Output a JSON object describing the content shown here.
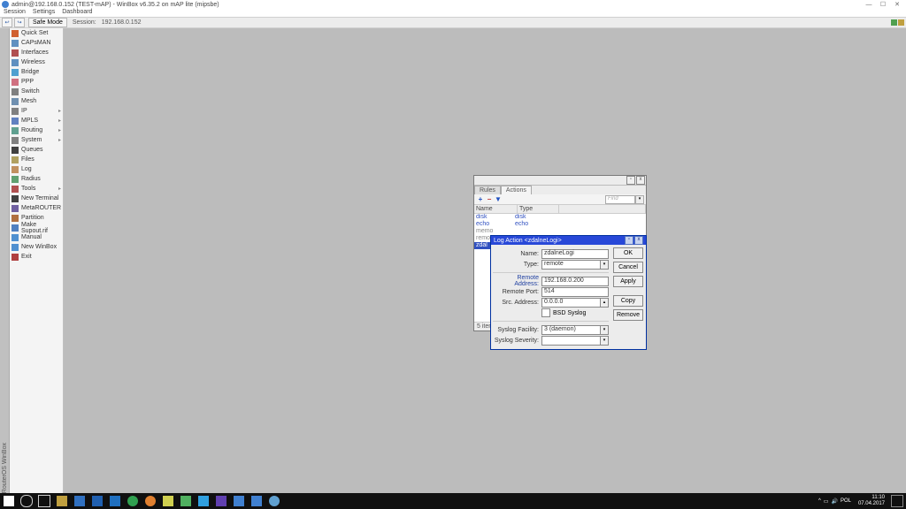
{
  "title": "admin@192.168.0.152 (TEST-mAP) - WinBox v6.35.2 on mAP lite (mipsbe)",
  "menu": {
    "session": "Session",
    "settings": "Settings",
    "dashboard": "Dashboard"
  },
  "toolbar": {
    "safe": "Safe Mode",
    "session_lbl": "Session:",
    "session_ip": "192.168.0.152"
  },
  "vbar_text": "RouterOS WinBox",
  "sidebar": [
    {
      "label": "Quick Set",
      "color": "#d06030"
    },
    {
      "label": "CAPsMAN",
      "color": "#6090c0"
    },
    {
      "label": "Interfaces",
      "color": "#b05050"
    },
    {
      "label": "Wireless",
      "color": "#6090c0"
    },
    {
      "label": "Bridge",
      "color": "#50a0d0"
    },
    {
      "label": "PPP",
      "color": "#d07080"
    },
    {
      "label": "Switch",
      "color": "#808080"
    },
    {
      "label": "Mesh",
      "color": "#7090b0"
    },
    {
      "label": "IP",
      "color": "#808080",
      "sub": true
    },
    {
      "label": "MPLS",
      "color": "#6080c0",
      "sub": true
    },
    {
      "label": "Routing",
      "color": "#60a090",
      "sub": true
    },
    {
      "label": "System",
      "color": "#808080",
      "sub": true
    },
    {
      "label": "Queues",
      "color": "#404040"
    },
    {
      "label": "Files",
      "color": "#b0a060"
    },
    {
      "label": "Log",
      "color": "#c09060"
    },
    {
      "label": "Radius",
      "color": "#60a070"
    },
    {
      "label": "Tools",
      "color": "#b05050",
      "sub": true
    },
    {
      "label": "New Terminal",
      "color": "#404040"
    },
    {
      "label": "MetaROUTER",
      "color": "#7060a0"
    },
    {
      "label": "Partition",
      "color": "#b07040"
    },
    {
      "label": "Make Supout.rif",
      "color": "#5080c0"
    },
    {
      "label": "Manual",
      "color": "#5090d0"
    },
    {
      "label": "New WinBox",
      "color": "#5090d0"
    },
    {
      "label": "Exit",
      "color": "#b04040"
    }
  ],
  "w1": {
    "tab_rules": "Rules",
    "tab_actions": "Actions",
    "find": "Find",
    "col_name": "Name",
    "col_type": "Type",
    "rows": [
      {
        "n": "disk",
        "t": "disk"
      },
      {
        "n": "echo",
        "t": "echo"
      },
      {
        "n": "memo",
        "t": ""
      },
      {
        "n": "remo",
        "t": ""
      },
      {
        "n": "zdal",
        "t": ""
      }
    ],
    "status": "5 items"
  },
  "w2": {
    "title": "Log Action <zdalneLogi>",
    "lbl": {
      "name": "Name:",
      "type": "Type:",
      "raddr": "Remote Address:",
      "rport": "Remote Port:",
      "saddr": "Src. Address:",
      "bsd": "BSD Syslog",
      "fac": "Syslog Facility:",
      "sev": "Syslog Severity:"
    },
    "val": {
      "name": "zdalneLogi",
      "type": "remote",
      "raddr": "192.168.0.200",
      "rport": "514",
      "saddr": "0.0.0.0",
      "fac": "3 (daemon)",
      "sev": ""
    },
    "btn": {
      "ok": "OK",
      "cancel": "Cancel",
      "apply": "Apply",
      "copy": "Copy",
      "remove": "Remove"
    }
  },
  "win_btns": {
    "min": "—",
    "max": "☐",
    "close": "✕"
  },
  "tray": {
    "lang": "POL",
    "time": "11:10",
    "date": "07.04.2017"
  }
}
